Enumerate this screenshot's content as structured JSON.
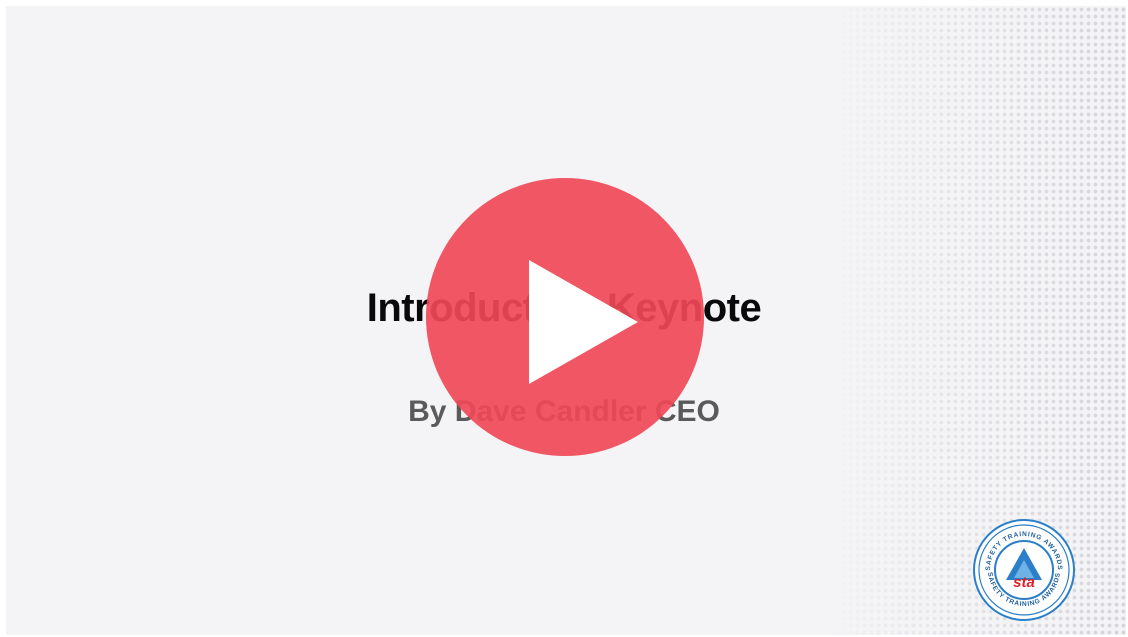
{
  "slide": {
    "title": "Introductory Keynote",
    "subtitle": "By Dave Candler CEO"
  },
  "player": {
    "play_icon": "play-icon",
    "accent_color": "#ef4856"
  },
  "logo": {
    "text": "sta",
    "ring_text_top": "SAFETY TRAINING AWARDS",
    "ring_text_bottom": "SAFETY TRAINING AWARDS",
    "brand_color": "#1e6fb8"
  }
}
